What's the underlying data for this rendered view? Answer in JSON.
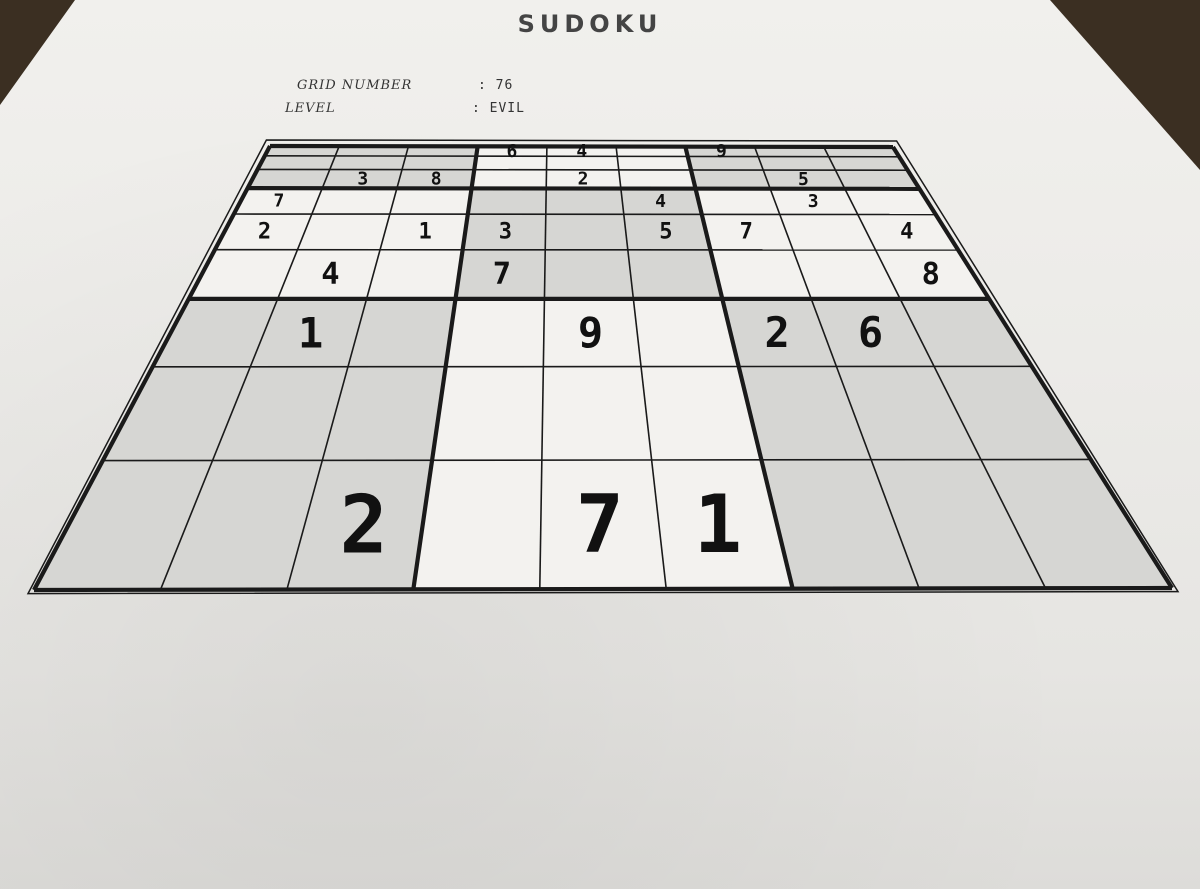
{
  "title": "SUDOKU",
  "meta": {
    "grid_number_label": "GRID NUMBER",
    "grid_number_value": ": 76",
    "level_label": "LEVEL",
    "level_value": ": EVIL"
  },
  "colors": {
    "shaded_cell": "#d6d6d3",
    "white_cell": "#f3f2ef",
    "line": "#1a1a1a"
  },
  "grid": [
    [
      null,
      null,
      null,
      6,
      4,
      null,
      9,
      null,
      null
    ],
    [
      null,
      null,
      null,
      null,
      null,
      null,
      null,
      null,
      null
    ],
    [
      null,
      3,
      8,
      null,
      2,
      null,
      null,
      5,
      null
    ],
    [
      7,
      null,
      null,
      null,
      null,
      4,
      null,
      3,
      null
    ],
    [
      2,
      null,
      1,
      3,
      null,
      5,
      7,
      null,
      4
    ],
    [
      null,
      4,
      null,
      7,
      null,
      null,
      null,
      null,
      8
    ],
    [
      null,
      1,
      null,
      null,
      9,
      null,
      2,
      6,
      null
    ],
    [
      null,
      null,
      null,
      null,
      null,
      null,
      null,
      null,
      null
    ],
    [
      null,
      null,
      2,
      null,
      7,
      1,
      null,
      null,
      null
    ]
  ],
  "shaded_boxes": [
    [
      true,
      false,
      true
    ],
    [
      false,
      true,
      false
    ],
    [
      true,
      false,
      true
    ]
  ]
}
